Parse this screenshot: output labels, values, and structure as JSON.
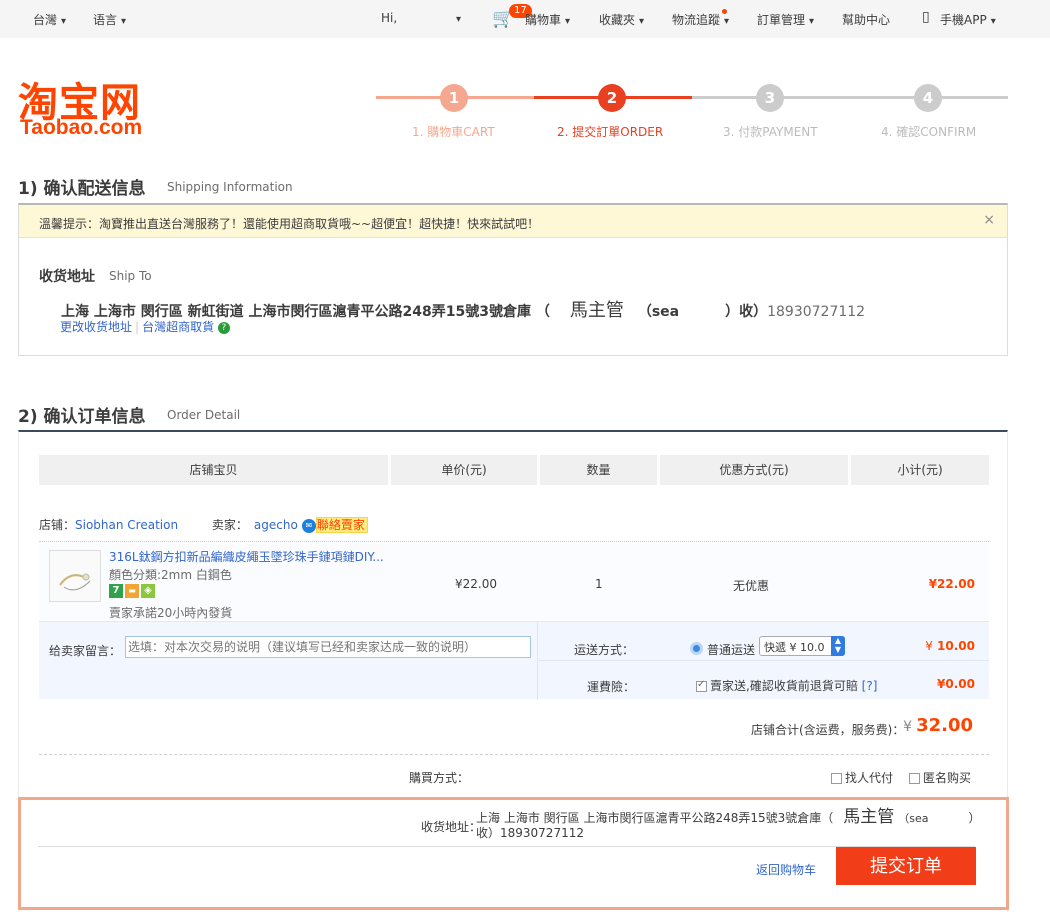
{
  "topbar": {
    "region": "台灣",
    "language": "语言",
    "greeting": "Hi,",
    "cart_count": "17",
    "cart": "購物車",
    "favorites": "收藏夾",
    "logistics": "物流追蹤",
    "orders": "訂單管理",
    "help": "幫助中心",
    "app": "手機APP"
  },
  "logo": {
    "cn": "淘宝网",
    "en": "Taobao.com"
  },
  "steps": [
    {
      "num": "1",
      "label": "1. 購物車CART"
    },
    {
      "num": "2",
      "label": "2. 提交訂單ORDER"
    },
    {
      "num": "3",
      "label": "3. 付款PAYMENT"
    },
    {
      "num": "4",
      "label": "4. 確認CONFIRM"
    }
  ],
  "shipping": {
    "title": "1) 确认配送信息",
    "subtitle": "Shipping Information",
    "notice": "溫馨提示：淘寶推出直送台灣服務了！還能使用超商取貨哦~~超便宜！超快捷！快來試試吧！",
    "close": "×",
    "ship_to_label": "收货地址",
    "ship_to_en": "Ship To",
    "address": "上海 上海市 閔行區 新虹街道 上海市閔行區滬青平公路248弄15號3號倉庫 （",
    "recipient": "馬主管",
    "recipient_extra": "（sea",
    "recipient_close": "）收）",
    "phone": "18930727112",
    "change_link": "更改收货地址",
    "pickup_link": "台灣超商取貨",
    "help_icon": "?"
  },
  "order": {
    "title": "2) 确认订单信息",
    "subtitle": "Order Detail",
    "headers": [
      "店铺宝贝",
      "单价(元)",
      "数量",
      "优惠方式(元)",
      "小计(元)"
    ],
    "shop_label": "店铺：",
    "shop_name": "Siobhan Creation",
    "seller_label": "卖家：",
    "seller_name": "agecho",
    "contact": "聯絡賣家",
    "item": {
      "title": "316L鈦鋼方扣新品編織皮繩玉墜珍珠手鏈項鏈DIY...",
      "spec": "顏色分類:2mm 白鋼色",
      "promise": "賣家承諾20小時內發貨",
      "price": "¥22.00",
      "qty": "1",
      "discount": "无优惠",
      "subtotal": "¥22.00"
    },
    "message_label": "给卖家留言：",
    "message_placeholder": "选填：对本次交易的说明（建议填写已经和卖家达成一致的说明）",
    "ship_method_label": "运送方式：",
    "ship_method": "普通运送",
    "ship_select": "快遞 ¥ 10.0",
    "ship_fee_yen": "¥",
    "ship_fee": "10.00",
    "insurance_label": "運費險：",
    "insurance_opt": "賣家送,確認收貨前退貨可賠",
    "insurance_help": "[?]",
    "insurance_fee": "¥0.00",
    "total_label": "店铺合计(含运费，服务费)：",
    "total_yen": "¥",
    "total": "32.00",
    "buy_label": "購買方式：",
    "buy_opt1": "找人代付",
    "buy_opt2": "匿名购买"
  },
  "confirm": {
    "label": "收货地址：",
    "address": "上海 上海市 閔行區 上海市閔行區滬青平公路248弄15號3號倉庫（",
    "recipient": "馬主管",
    "recipient_extra": "（sea",
    "close_paren": "）",
    "line2": "收）18930727112",
    "back": "返回购物车",
    "submit": "提交订单"
  },
  "colors": {
    "accent": "#ff4400",
    "step_done": "#f5a88f",
    "step_pending": "#cccccc"
  }
}
